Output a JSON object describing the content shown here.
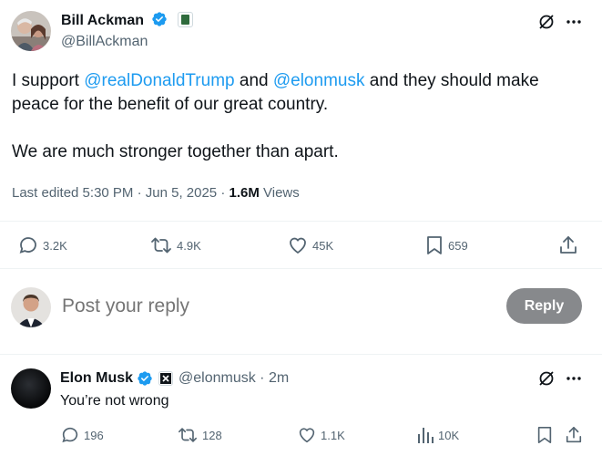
{
  "main_tweet": {
    "author_name": "Bill Ackman",
    "author_handle": "@BillAckman",
    "text_line1_prefix": "I support ",
    "mention1": "@realDonaldTrump",
    "text_line1_middle": " and ",
    "mention2": "@elonmusk",
    "text_line1_suffix": " and they should make",
    "text_line2": "peace for the benefit of our great country.",
    "text_para2": "We are much stronger together than apart.",
    "meta_prefix": "Last edited 5:30 PM · Jun 5, 2025 · ",
    "views_count": "1.6M",
    "views_label": " Views",
    "stats": {
      "replies": "3.2K",
      "reposts": "4.9K",
      "likes": "45K",
      "bookmarks": "659"
    }
  },
  "composer": {
    "placeholder": "Post your reply",
    "button_label": "Reply"
  },
  "reply_tweet": {
    "author_name": "Elon Musk",
    "author_handle": "@elonmusk · 2m",
    "text": "You’re not wrong",
    "stats": {
      "replies": "196",
      "reposts": "128",
      "likes": "1.1K",
      "views": "10K"
    }
  },
  "colors": {
    "accent": "#1d9bf0",
    "muted": "#536471",
    "reply_button": "#87898c"
  }
}
